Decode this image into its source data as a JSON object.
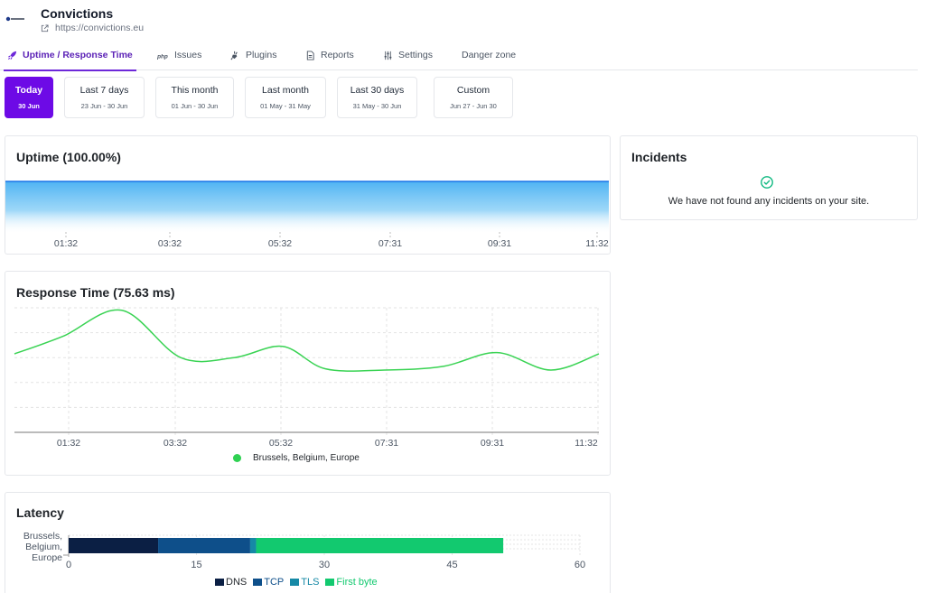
{
  "site": {
    "name": "Convictions",
    "url": "https://convictions.eu",
    "logo": "convictions-logo"
  },
  "tabs": [
    {
      "label": "Uptime / Response Time",
      "icon": "rocket-icon",
      "active": true
    },
    {
      "label": "Issues",
      "icon": "php-icon",
      "active": false
    },
    {
      "label": "Plugins",
      "icon": "plug-icon",
      "active": false
    },
    {
      "label": "Reports",
      "icon": "document-icon",
      "active": false
    },
    {
      "label": "Settings",
      "icon": "sliders-icon",
      "active": false
    },
    {
      "label": "Danger zone",
      "icon": "",
      "active": false
    }
  ],
  "ranges": [
    {
      "label": "Today",
      "dates": "30 Jun",
      "active": true
    },
    {
      "label": "Last 7 days",
      "dates": "23 Jun - 30 Jun",
      "active": false
    },
    {
      "label": "This month",
      "dates": "01 Jun - 30 Jun",
      "active": false
    },
    {
      "label": "Last month",
      "dates": "01 May - 31 May",
      "active": false
    },
    {
      "label": "Last 30 days",
      "dates": "31 May - 30 Jun",
      "active": false
    },
    {
      "label": "Custom",
      "dates": "Jun 27 - Jun 30",
      "active": false
    }
  ],
  "uptime": {
    "title": "Uptime (100.00%)"
  },
  "response_time": {
    "title": "Response Time (75.63 ms)"
  },
  "latency": {
    "title": "Latency"
  },
  "incidents": {
    "title": "Incidents",
    "message": "We have not found any incidents on your site.",
    "icon": "check-circle-icon"
  },
  "colors": {
    "accent": "#6d0ae6",
    "uptime_line": "#1a73e8",
    "uptime_fill": "#5ab7f2",
    "response_line": "#39d353",
    "dns": "#0b1f44",
    "tcp": "#0e4f8a",
    "tls": "#1689a6",
    "first_byte": "#12c96f",
    "ok_green": "#10b981"
  },
  "chart_data": [
    {
      "type": "area",
      "title": "Uptime (100.00%)",
      "x": [
        "01:32",
        "03:32",
        "05:32",
        "07:31",
        "09:31",
        "11:32"
      ],
      "xlabel": "",
      "ylabel": "",
      "series": [
        {
          "values": [
            100,
            100,
            100,
            100,
            100,
            100
          ]
        }
      ],
      "ylim": [
        0,
        100
      ],
      "grid": false
    },
    {
      "type": "line",
      "title": "Response Time (75.63 ms)",
      "x": [
        "01:32",
        "03:32",
        "05:32",
        "07:31",
        "09:31",
        "11:32"
      ],
      "xlabel": "",
      "ylabel": "",
      "series": [
        {
          "name": "Brussels, Belgium, Europe",
          "points": [
            [
              0,
              83
            ],
            [
              0.9,
              97
            ],
            [
              2.0,
              118
            ],
            [
              3.1,
              80
            ],
            [
              4.1,
              80
            ],
            [
              5.0,
              89
            ],
            [
              5.8,
              71
            ],
            [
              6.9,
              70
            ],
            [
              8.0,
              73
            ],
            [
              9.0,
              84
            ],
            [
              10.0,
              70
            ],
            [
              10.9,
              83
            ]
          ]
        }
      ],
      "xlim": [
        0,
        10.9
      ],
      "ylim": [
        20,
        120
      ],
      "grid": true,
      "legend": "bottom"
    },
    {
      "type": "bar",
      "orientation": "horizontal",
      "stacked": true,
      "title": "Latency",
      "categories": [
        "Brussels, Belgium, Europe"
      ],
      "series": [
        {
          "name": "DNS",
          "values": [
            10.5
          ]
        },
        {
          "name": "TCP",
          "values": [
            10.8
          ]
        },
        {
          "name": "TLS",
          "values": [
            0.7
          ]
        },
        {
          "name": "First byte",
          "values": [
            29.0
          ]
        }
      ],
      "xticks": [
        0,
        15,
        30,
        45,
        60
      ],
      "xlim": [
        0,
        60
      ],
      "grid": true,
      "legend": "bottom"
    }
  ]
}
